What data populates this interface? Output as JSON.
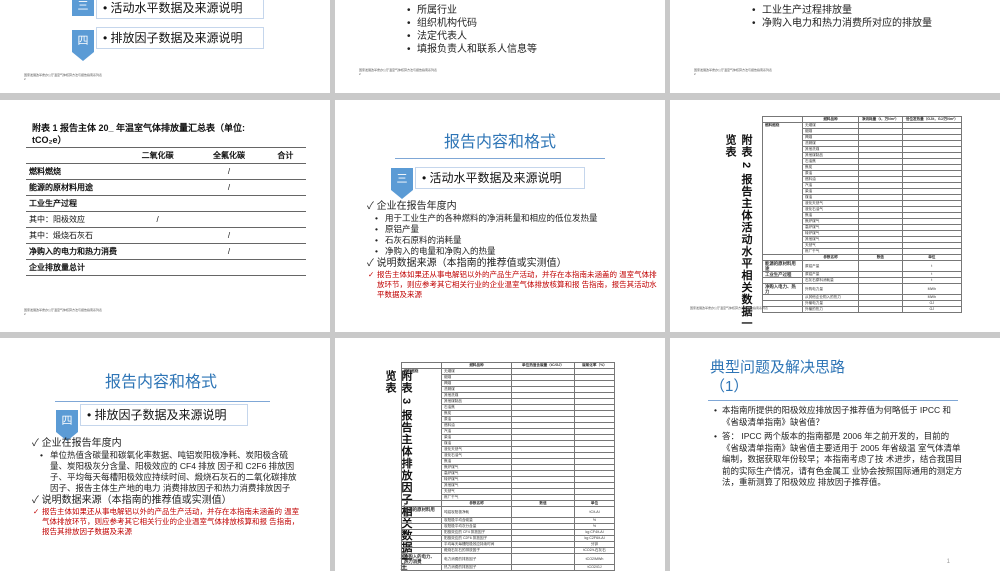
{
  "footer_text": "国家发展改革委办公厅温室气体核算方法与报告指南系列表",
  "footer_page": "2",
  "slide1": {
    "sec3_num": "三",
    "sec3_label": "活动水平数据及来源说明",
    "sec4_num": "四",
    "sec4_label": "排放因子数据及来源说明"
  },
  "slide2": {
    "items": [
      "所属行业",
      "组织机构代码",
      "法定代表人",
      "填报负责人和联系人信息等"
    ]
  },
  "slide3": {
    "items": [
      "工业生产过程排放量",
      "净购入电力和热力消费所对应的排放量"
    ]
  },
  "slide4": {
    "title_line1": "附表 1 报告主体 20_ 年温室气体排放量汇总表（单位:",
    "title_line2": "tCO₂e）",
    "col_headers": [
      "",
      "二氧化碳",
      "全氟化碳",
      "合计"
    ],
    "rows": [
      {
        "label": "燃料燃烧",
        "bold": true,
        "marks": [
          "",
          "/",
          ""
        ]
      },
      {
        "label": "能源的原材料用途",
        "bold": true,
        "marks": [
          "",
          "/",
          ""
        ]
      },
      {
        "label": "工业生产过程",
        "bold": true,
        "marks": [
          "",
          "",
          ""
        ]
      },
      {
        "label": "其中：阳极效应",
        "bold": false,
        "marks": [
          "/",
          "",
          ""
        ]
      },
      {
        "label": "其中：煅烧石灰石",
        "bold": false,
        "marks": [
          "",
          "/",
          ""
        ]
      },
      {
        "label": "净购入的电力和热力消费",
        "bold": true,
        "marks": [
          "",
          "/",
          ""
        ]
      },
      {
        "label": "企业排放量总计",
        "bold": true,
        "marks": [
          "",
          "",
          ""
        ]
      }
    ]
  },
  "slide5": {
    "title": "报告内容和格式",
    "sec_num": "三",
    "sec_label": "活动水平数据及来源说明",
    "main1": "企业在报告年度内",
    "subs": [
      "用于工业生产的各种燃料的净消耗量和相应的低位发热量",
      "原铝产量",
      "石灰石原料的消耗量",
      "净购入的电量和净购入的热量"
    ],
    "main2": "说明数据来源（本指南的推荐值或实测值）",
    "red_text": "报告主体如果还从事电解铝以外的产品生产活动，并存在本指南未涵盖的 温室气体排放环节，则应参考其它相关行业的企业温室气体排放核算和报 告指南，报告其活动水平数据及来源"
  },
  "slide6": {
    "vtitle": "附表 2 报告主体活动水平相关数据一览表",
    "headers": [
      "",
      "燃料品种",
      "净消耗量（t，万Nm³）",
      "低位发热量（GJ/t，GJ/万Nm³）"
    ],
    "group_label": "燃料燃烧",
    "fuels": [
      "无烟煤",
      "烟煤",
      "褐煤",
      "洗精煤",
      "其他洗煤",
      "其他煤制品",
      "石油焦",
      "焦炭",
      "原油",
      "燃料油",
      "汽油",
      "柴油",
      "煤油",
      "液化天然气",
      "液化石油气",
      "焦油",
      "焦炉煤气",
      "高炉煤气",
      "转炉煤气",
      "其他煤气",
      "天然气",
      "炼厂干气"
    ],
    "sub_headers": [
      "参数名称",
      "数值",
      "单位"
    ],
    "sub_rows": [
      {
        "group": "能源的原材料用途",
        "name": "原铝产量",
        "unit": "t"
      },
      {
        "group": "工业生产过程",
        "name": "原铝产量",
        "unit": "t"
      },
      {
        "group": "",
        "name": "石灰石原料消耗量",
        "unit": "t"
      },
      {
        "group": "净购入电力、热力",
        "name": "外购电力量",
        "unit": "MWh"
      },
      {
        "group": "",
        "name": "从其他企业购入的热力",
        "unit": "MWh"
      },
      {
        "group": "",
        "name": "外输电力量",
        "unit": "GJ"
      },
      {
        "group": "",
        "name": "外输的热力",
        "unit": "GJ"
      }
    ]
  },
  "slide7": {
    "title": "报告内容和格式",
    "sec_num": "四",
    "sec_label": "排放因子数据及来源说明",
    "main1": "企业在报告年度内",
    "sub": "单位热值含碳量和碳氧化率数据、吨铝炭阳极净耗、炭阳极含硫量、炭阳极灰分含量、阳极效应的 CF4 排放 因子和 C2F6 排放因子、平均每天每槽阳极效应持续时间、煅烧石灰石的二氧化碳排放因子、报告主体生产地的电力 消费排放因子和热力消费排放因子",
    "main2": "说明数据来源（本指南的推荐值或实测值）",
    "red_text": "报告主体如果还从事电解铝以外的产品生产活动，并存在本指南未涵盖的 温室气体排放环节，则应参考其它相关行业的企业温室气体排放核算和报 告指南，报告其排放因子数据及来源"
  },
  "slide8": {
    "vtitle": "附表 3 报告主体排放因子相关数据一览表",
    "vtitle_extra": "业 生",
    "headers": [
      "",
      "燃料品种",
      "单位热值含碳量（tC/GJ）",
      "碳氧化率（%）"
    ],
    "group_label": "燃料燃烧",
    "fuels": [
      "无烟煤",
      "烟煤",
      "褐煤",
      "洗精煤",
      "其他洗煤",
      "其他煤制品",
      "石油焦",
      "焦炭",
      "原油",
      "燃料油",
      "汽油",
      "柴油",
      "煤油",
      "液化天然气",
      "液化石油气",
      "焦油",
      "焦炉煤气",
      "高炉煤气",
      "转炉煤气",
      "其他煤气",
      "天然气",
      "炼厂干气"
    ],
    "sub_headers": [
      "参数名称",
      "数值",
      "单位"
    ],
    "sub_rows": [
      {
        "group": "能源的原材料用途",
        "name": "吨铝炭阳极净耗",
        "unit": "tC/t-Al"
      },
      {
        "group": "",
        "name": "炭阳极平均含硫量",
        "unit": "%"
      },
      {
        "group": "",
        "name": "炭阳极平均灰分含量",
        "unit": "%"
      },
      {
        "group": "",
        "name": "阳极效应的 CF4 排放因子",
        "unit": "kg CF4/t-Al"
      },
      {
        "group": "",
        "name": "阳极效应的 C2F6 排放因子",
        "unit": "kg C2F6/t-Al"
      },
      {
        "group": "",
        "name": "平均每天每槽阳极效应持续时间",
        "unit": "分钟"
      },
      {
        "group": "",
        "name": "煅烧石灰石的排放因子",
        "unit": "tCO2/t-石灰石"
      },
      {
        "group": "净购入的电力、热力消费",
        "name": "电力消费的排放因子",
        "unit": "tCO2/MWh"
      },
      {
        "group": "",
        "name": "热力消费的排放因子",
        "unit": "tCO2/GJ"
      }
    ]
  },
  "slide9": {
    "title_line1": "典型问题及解决思路",
    "title_line2": "（1）",
    "q": "本指南所提供的阳极效应排放因子推荐值为何略低于 IPCC 和《省级清单指南》缺省值？",
    "a": "答： IPCC 两个版本的指南都是 2006 年之前开发的，目前的《省级清单指南》缺省值主要适用于 2005 年省级温 室气体清单编制，数据获取年份较早；本指南考虑了技 术进步，结合我国目前的实际生产情况，请有色金属工 业协会按照国际通用的测定方法，重新测算了阳极效应 排放因子推荐值。",
    "page_no": "1"
  }
}
